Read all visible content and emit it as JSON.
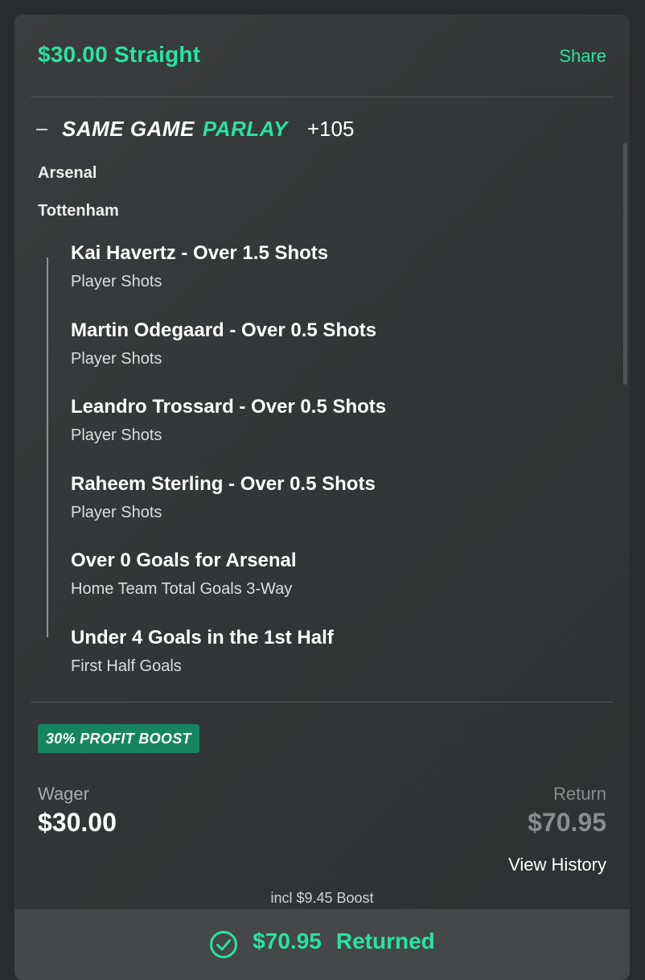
{
  "header": {
    "title": "$30.00 Straight",
    "share_label": "Share"
  },
  "parlay": {
    "label_same_game": "SAME GAME",
    "label_parlay": "PARLAY",
    "odds": "+105",
    "teams": [
      "Arsenal",
      "Tottenham"
    ],
    "legs": [
      {
        "title": "Kai Havertz - Over 1.5 Shots",
        "market": "Player Shots"
      },
      {
        "title": "Martin Odegaard - Over 0.5 Shots",
        "market": "Player Shots"
      },
      {
        "title": "Leandro Trossard - Over 0.5 Shots",
        "market": "Player Shots"
      },
      {
        "title": "Raheem Sterling - Over 0.5 Shots",
        "market": "Player Shots"
      },
      {
        "title": "Over 0 Goals for Arsenal",
        "market": "Home Team Total Goals 3-Way"
      },
      {
        "title": "Under 4 Goals in the 1st Half",
        "market": "First Half Goals"
      }
    ]
  },
  "boost": {
    "badge": "30% PROFIT BOOST",
    "note": "incl $9.45 Boost"
  },
  "wager": {
    "label": "Wager",
    "value": "$30.00"
  },
  "return": {
    "label": "Return",
    "value": "$70.95"
  },
  "view_history_label": "View History",
  "result": {
    "amount": "$70.95",
    "status": "Returned"
  },
  "icons": {
    "collapse": "minus-icon",
    "status": "check-circle-icon"
  },
  "colors": {
    "accent": "#29e3a0",
    "boost_badge": "#178460",
    "card_bg": "#363939",
    "page_bg": "#2a2b2c"
  }
}
